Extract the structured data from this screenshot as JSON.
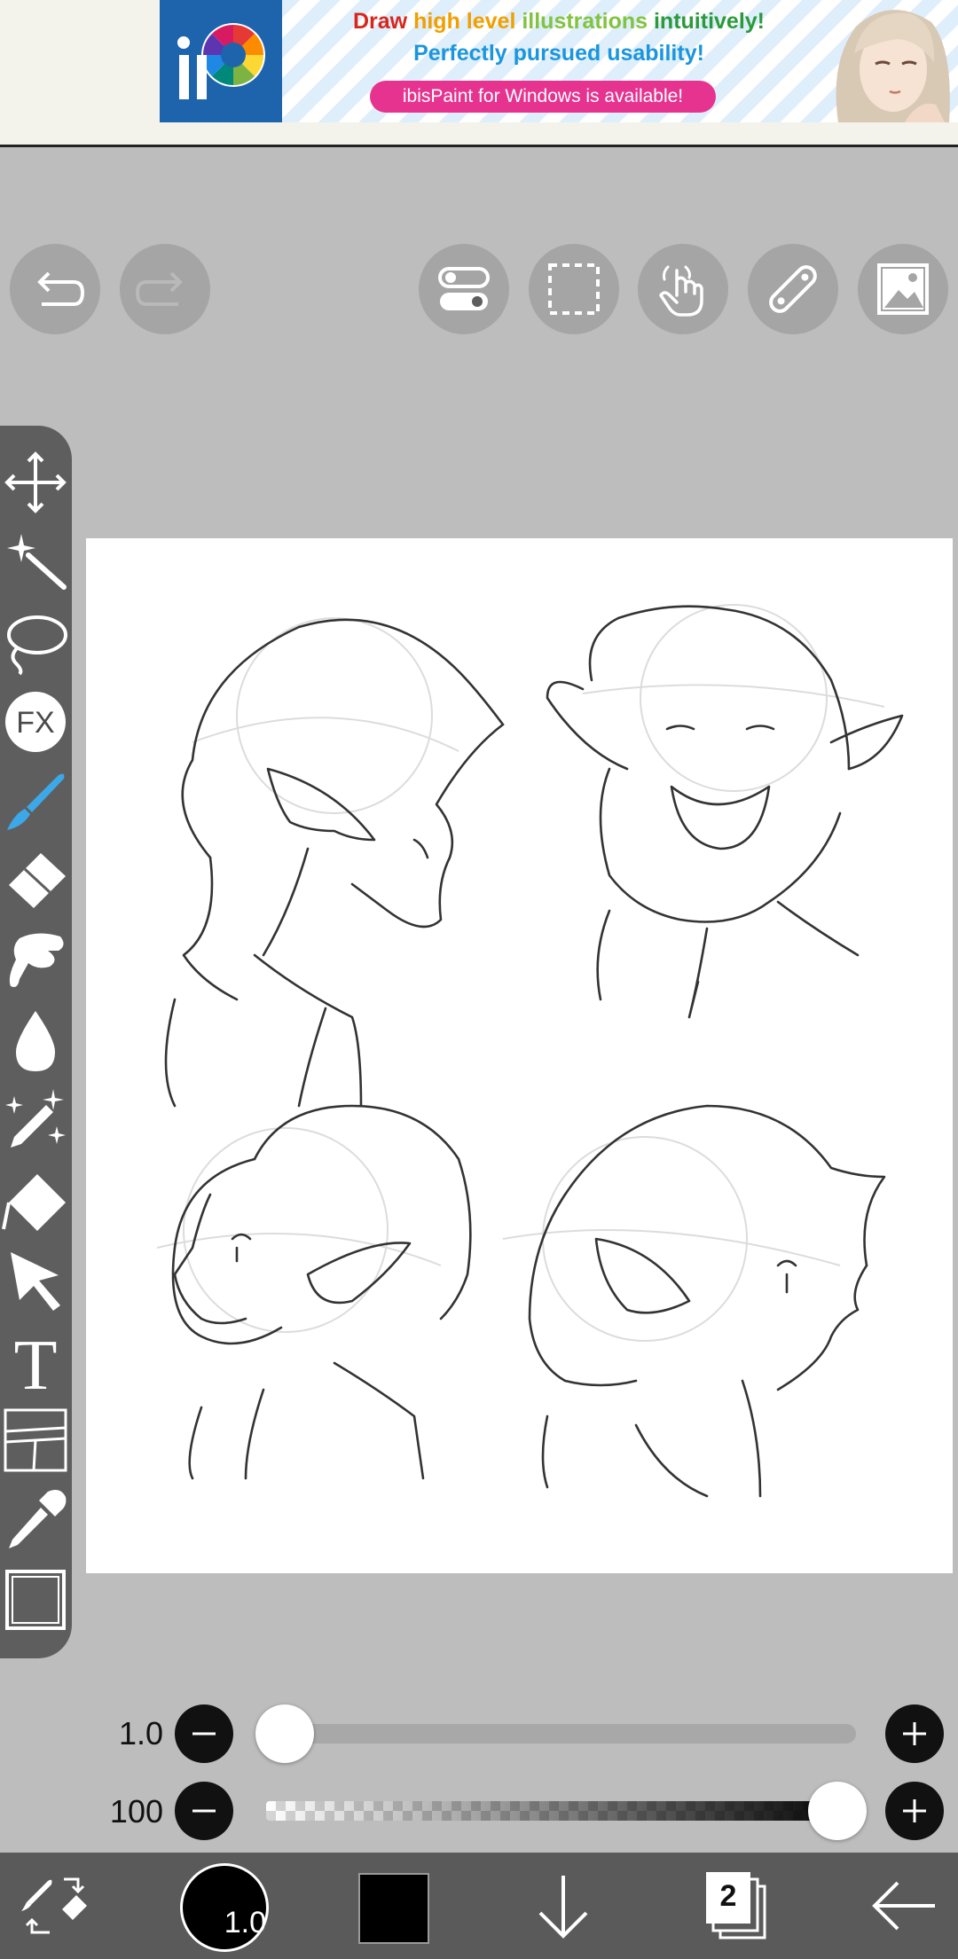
{
  "ad": {
    "line1": {
      "p1": "Draw ",
      "p2": "high level ",
      "p3": "illustrations ",
      "p4": "intuitively!"
    },
    "line2": "Perfectly pursued usability!",
    "cta": "ibisPaint for Windows is available!",
    "logo_icon": "ibispaint-logo-icon",
    "colors": {
      "logo_bg": "#1d64ad",
      "cta_bg": "#e5338f",
      "line2": "#1a96de"
    }
  },
  "toolbar": {
    "left_buttons": [
      "undo-icon",
      "redo-icon"
    ],
    "right_buttons": [
      "toggle-icon",
      "selection-icon",
      "hand-icon",
      "ruler-icon",
      "image-icon"
    ]
  },
  "tools": [
    "move-icon",
    "magic-wand-icon",
    "lasso-icon",
    "fx-icon",
    "brush-icon",
    "eraser-icon",
    "smudge-icon",
    "blur-icon",
    "special-pen-icon",
    "fill-icon",
    "select-arrow-icon",
    "text-icon",
    "frame-divider-icon",
    "eyedropper-icon",
    "canvas-icon"
  ],
  "fx_label": "FX",
  "text_tool_label": "T",
  "brush_size": {
    "value": "1.0",
    "level": 0.0
  },
  "brush_opacity": {
    "value": "100",
    "level": 1.0
  },
  "bottom_bar": {
    "brush_size_label": "1.0",
    "color": "#000000",
    "layer_count": "2",
    "icons": [
      "swap-tool-icon",
      "brush-size-icon",
      "color-swatch-icon",
      "down-arrow-icon",
      "layers-icon",
      "back-arrow-icon"
    ]
  },
  "accent": "#3da8e8"
}
